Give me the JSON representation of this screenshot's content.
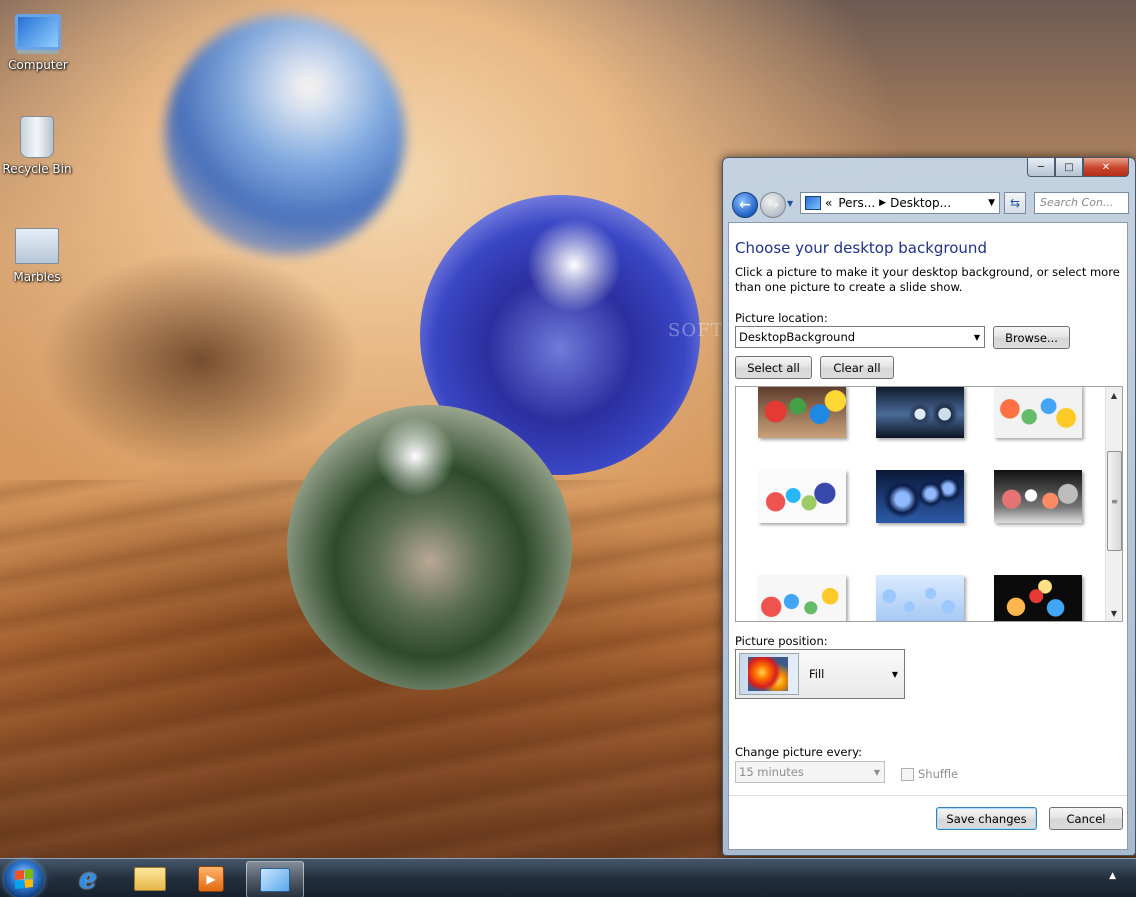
{
  "desktop": {
    "icons": [
      {
        "label": "Computer",
        "icon": "computer-icon"
      },
      {
        "label": "Recycle Bin",
        "icon": "recycle-bin-icon"
      },
      {
        "label": "Marbles",
        "icon": "theme-file-icon"
      }
    ],
    "watermark": "SOFTPEDIA"
  },
  "window": {
    "address": {
      "chevron": "«",
      "crumb1": "Pers...",
      "crumb2": "Desktop..."
    },
    "search_placeholder": "Search Con...",
    "heading": "Choose your desktop background",
    "description": "Click a picture to make it your desktop background, or select more than one picture to create a slide show.",
    "picture_location_label": "Picture location:",
    "picture_location_value": "DesktopBackground",
    "browse_label": "Browse...",
    "select_all_label": "Select all",
    "clear_all_label": "Clear all",
    "thumbnails": [
      {
        "name": "colorful-marbles-pile"
      },
      {
        "name": "dark-glass-spheres"
      },
      {
        "name": "marbles-on-white"
      },
      {
        "name": "marbles-row"
      },
      {
        "name": "blue-spheres-reflection"
      },
      {
        "name": "marbles-on-dark"
      },
      {
        "name": "marbles-corner"
      },
      {
        "name": "blue-bubbles"
      },
      {
        "name": "marbles-cluster-black"
      }
    ],
    "picture_position_label": "Picture position:",
    "picture_position_value": "Fill",
    "change_picture_label": "Change picture every:",
    "change_picture_value": "15 minutes",
    "shuffle_label": "Shuffle",
    "save_label": "Save changes",
    "cancel_label": "Cancel"
  },
  "colors": {
    "heading": "#1e3287",
    "taskbar": "#1c2838",
    "accent": "#3c7fb1"
  }
}
